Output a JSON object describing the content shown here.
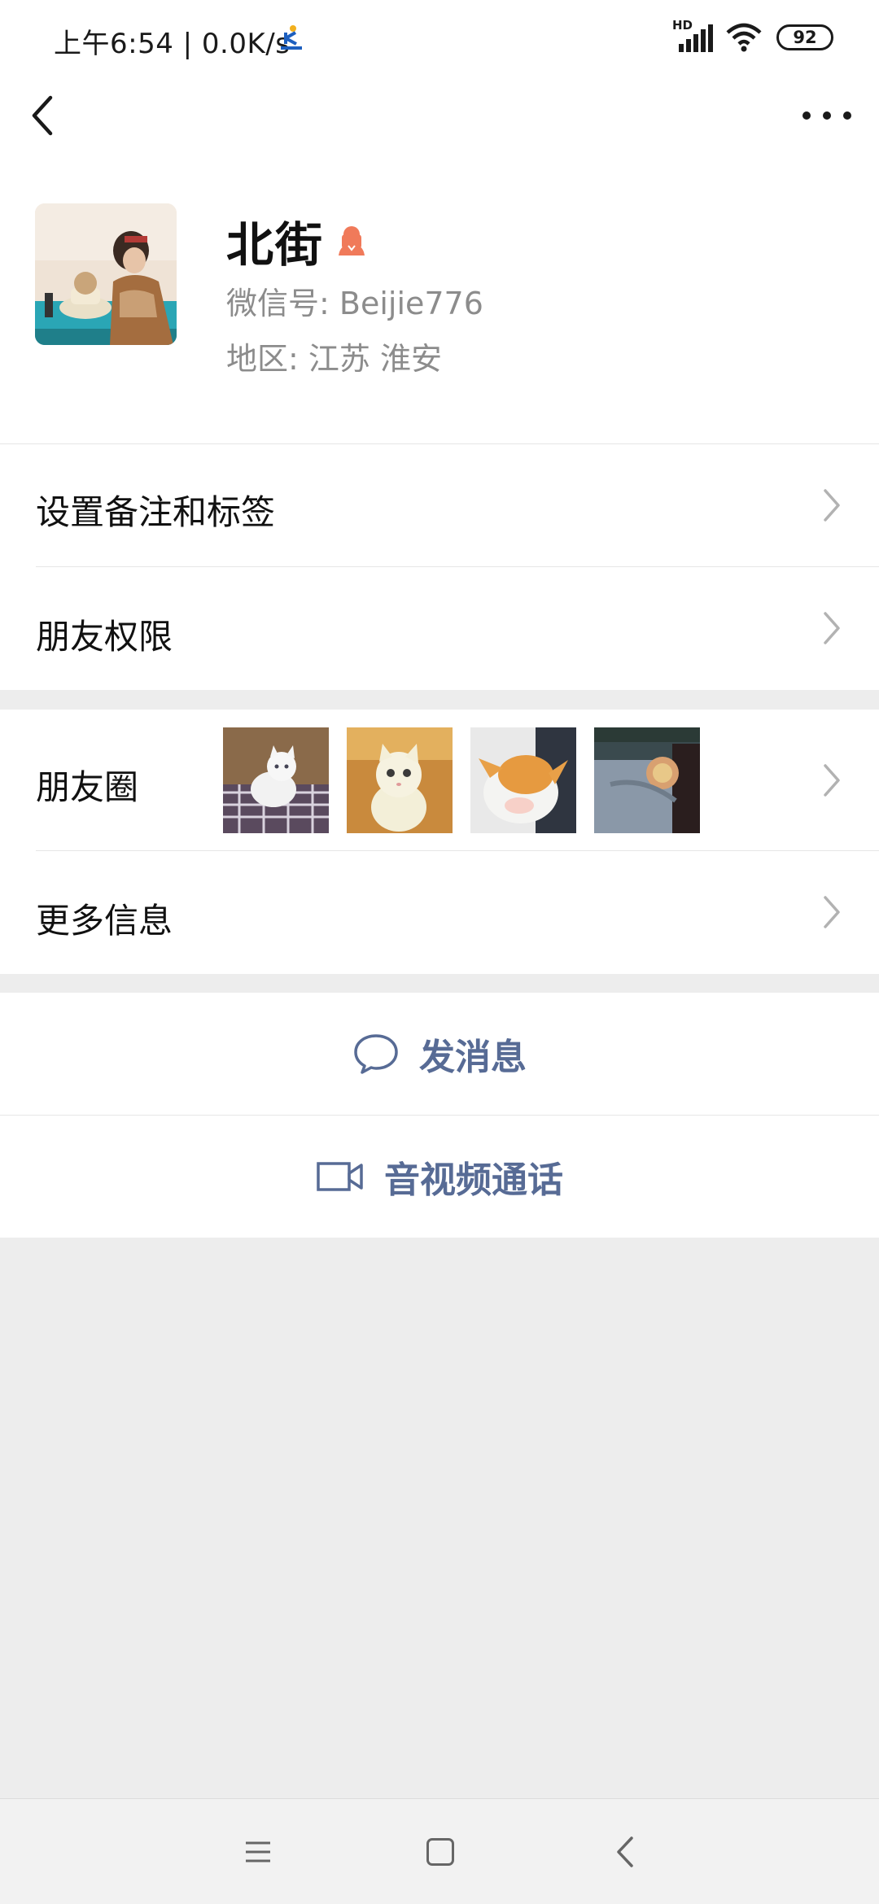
{
  "status_bar": {
    "time_speed": "上午6:54 | 0.0K/s",
    "network": "HD",
    "battery": "92"
  },
  "nav": {
    "back_icon": "back-chevron-icon",
    "more_icon": "more-dots-icon"
  },
  "profile": {
    "name": "北街",
    "gender_icon": "female-icon",
    "wechat_id": "微信号: Beijie776",
    "region": "地区: 江苏  淮安"
  },
  "list": {
    "remark_tags": "设置备注和标签",
    "friend_permissions": "朋友权限",
    "moments": "朋友圈",
    "more_info": "更多信息"
  },
  "actions": {
    "send_message": "发消息",
    "av_call": "音视频通话"
  },
  "colors": {
    "link_blue": "#576b95",
    "background": "#ededed",
    "female_accent": "#f07a5a"
  }
}
